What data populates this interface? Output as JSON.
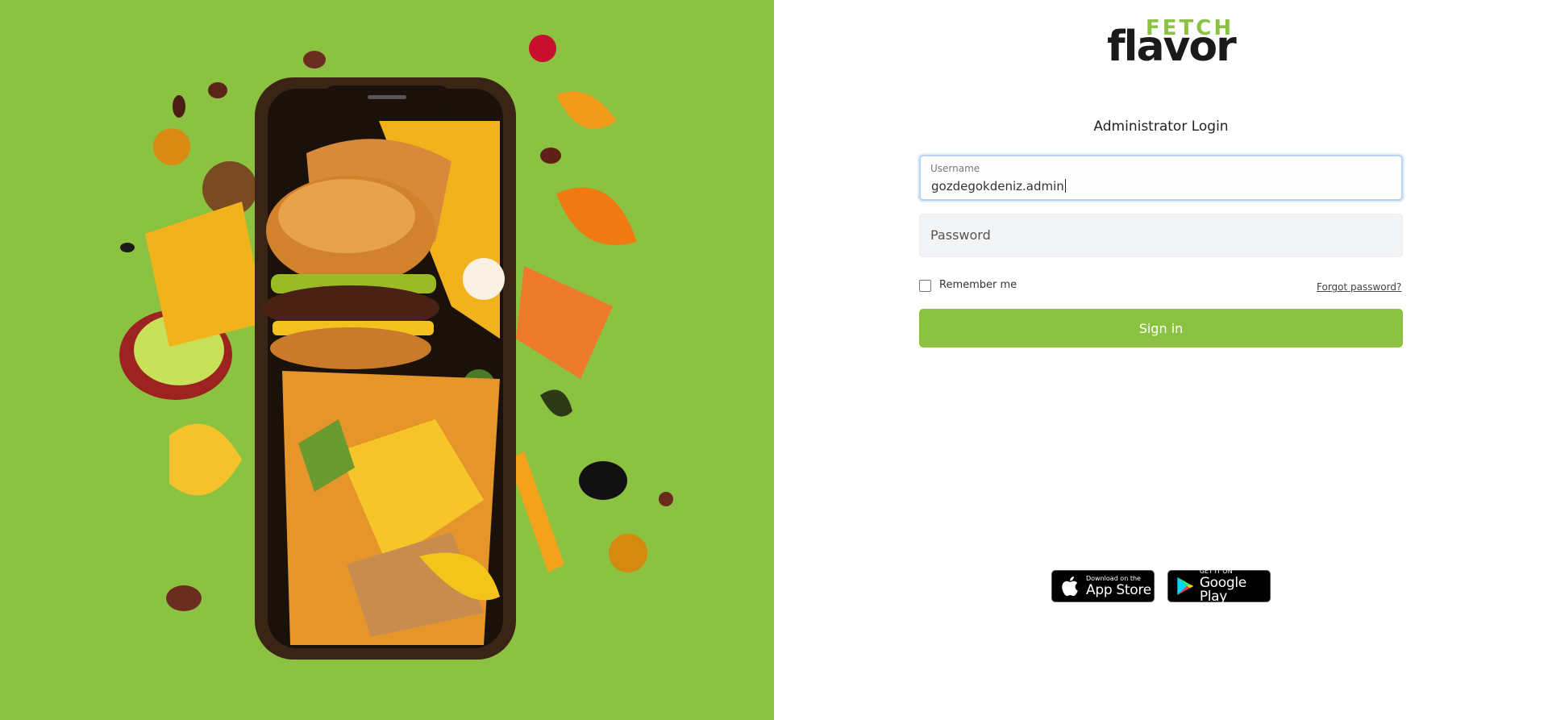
{
  "hero": {
    "image": "food-burst-phone-illustration",
    "background_color": "#8bc241"
  },
  "brand": {
    "name_top": "FETCH",
    "name_bottom": "flavor",
    "accent_color": "#8bc241"
  },
  "login": {
    "title": "Administrator Login",
    "username_label": "Username",
    "username_value": "gozdegokdeniz.admin",
    "password_placeholder": "Password",
    "remember_label": "Remember me",
    "remember_checked": false,
    "forgot_label": "Forgot password?",
    "signin_label": "Sign in"
  },
  "stores": {
    "apple_small": "Download on the",
    "apple_big": "App Store",
    "google_small": "GET IT ON",
    "google_big": "Google Play"
  }
}
